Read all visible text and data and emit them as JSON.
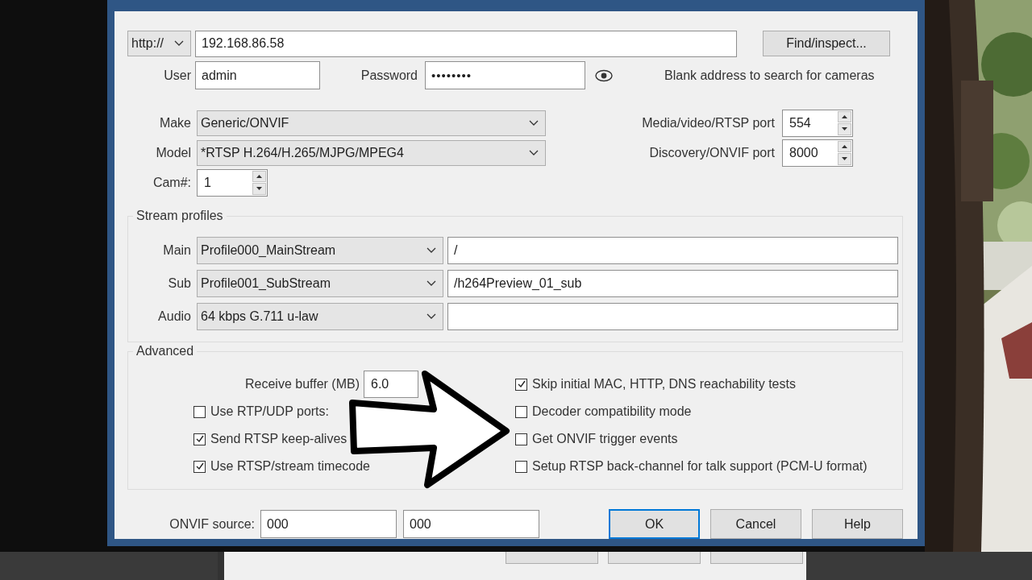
{
  "address": {
    "scheme": "http://",
    "host": "192.168.86.58"
  },
  "find_button": "Find/inspect...",
  "user": {
    "label": "User",
    "value": "admin"
  },
  "password": {
    "label": "Password",
    "value": "••••••••"
  },
  "hint": "Blank address to search for cameras",
  "camera": [
    {
      "label": "Make",
      "value": "Generic/ONVIF"
    },
    {
      "label": "Model",
      "value": "*RTSP H.264/H.265/MJPG/MPEG4"
    }
  ],
  "ports": [
    {
      "label": "Media/video/RTSP port",
      "value": "554"
    },
    {
      "label": "Discovery/ONVIF port",
      "value": "8000"
    }
  ],
  "cam_number": {
    "label": "Cam#:",
    "value": "1"
  },
  "stream_profiles": {
    "title": "Stream profiles",
    "rows": [
      {
        "label": "Main",
        "profile": "Profile000_MainStream",
        "path": "/"
      },
      {
        "label": "Sub",
        "profile": "Profile001_SubStream",
        "path": "/h264Preview_01_sub"
      },
      {
        "label": "Audio",
        "profile": "64 kbps G.711 u-law"
      }
    ]
  },
  "advanced": {
    "title": "Advanced",
    "receive_buffer": {
      "label": "Receive buffer (MB)",
      "value": "6.0"
    },
    "left_options": [
      {
        "label": "Use RTP/UDP ports:",
        "checked": false
      },
      {
        "label": "Send RTSP keep-alives",
        "checked": true
      },
      {
        "label": "Use RTSP/stream timecode",
        "checked": true
      }
    ],
    "right_options": [
      {
        "label": "Skip initial MAC, HTTP, DNS reachability tests",
        "checked": true
      },
      {
        "label": "Decoder compatibility mode",
        "checked": false
      },
      {
        "label": "Get ONVIF trigger events",
        "checked": false
      },
      {
        "label": "Setup RTSP back-channel for talk support (PCM-U format)",
        "checked": false
      }
    ]
  },
  "onvif_source": {
    "label": "ONVIF source:",
    "values": [
      "000",
      "000"
    ]
  },
  "buttons": [
    {
      "label": "OK",
      "selected": true
    },
    {
      "label": "Cancel",
      "selected": false
    },
    {
      "label": "Help",
      "selected": false
    }
  ]
}
